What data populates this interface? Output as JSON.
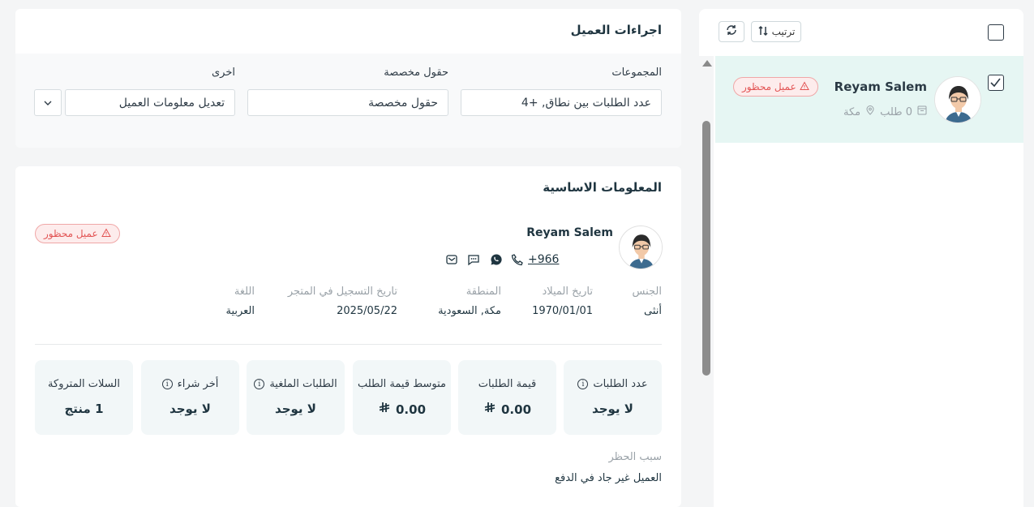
{
  "customer_list": {
    "sort_label": "ترتيب",
    "customer": {
      "name": "Reyam Salem",
      "orders": "0 طلب",
      "city": "مكة",
      "badge": "عميل محظور"
    }
  },
  "actions_card": {
    "title": "اجراءات العميل",
    "groups_label": "المجموعات",
    "groups_value": "عدد الطلبات بين نطاق, +4",
    "custom_fields_label": "حقول مخصصة",
    "custom_fields_value": "حقول مخصصة",
    "other_label": "اخرى",
    "other_value": "تعديل معلومات العميل"
  },
  "basic_card": {
    "title": "المعلومات الاساسية",
    "name": "Reyam Salem",
    "phone": "+966",
    "badge": "عميل محظور",
    "info": [
      {
        "label": "الجنس",
        "value": "أنثى"
      },
      {
        "label": "تاريخ الميلاد",
        "value": "1970/01/01"
      },
      {
        "label": "المنطقة",
        "value": "مكة, السعودية"
      },
      {
        "label": "تاريخ التسجيل في المتجر",
        "value": "2025/05/22"
      },
      {
        "label": "اللغة",
        "value": "العربية"
      }
    ],
    "stats": [
      {
        "label": "عدد الطلبات",
        "value": "لا يوجد"
      },
      {
        "label": "قيمة الطلبات",
        "value": "0.00"
      },
      {
        "label": "متوسط قيمة الطلب",
        "value": "0.00"
      },
      {
        "label": "الطلبات الملغية",
        "value": "لا يوجد"
      },
      {
        "label": "أخر شراء",
        "value": "لا يوجد"
      },
      {
        "label": "السلات المتروكة",
        "value": "1 منتج"
      }
    ],
    "ban_reason_label": "سبب الحظر",
    "ban_reason_value": "العميل غير جاد في الدفع"
  },
  "colors": {
    "accent": "#1f3540",
    "selected_row": "#e6f6f3",
    "danger": "#e25454",
    "stat_bg": "#f2f7f8"
  }
}
